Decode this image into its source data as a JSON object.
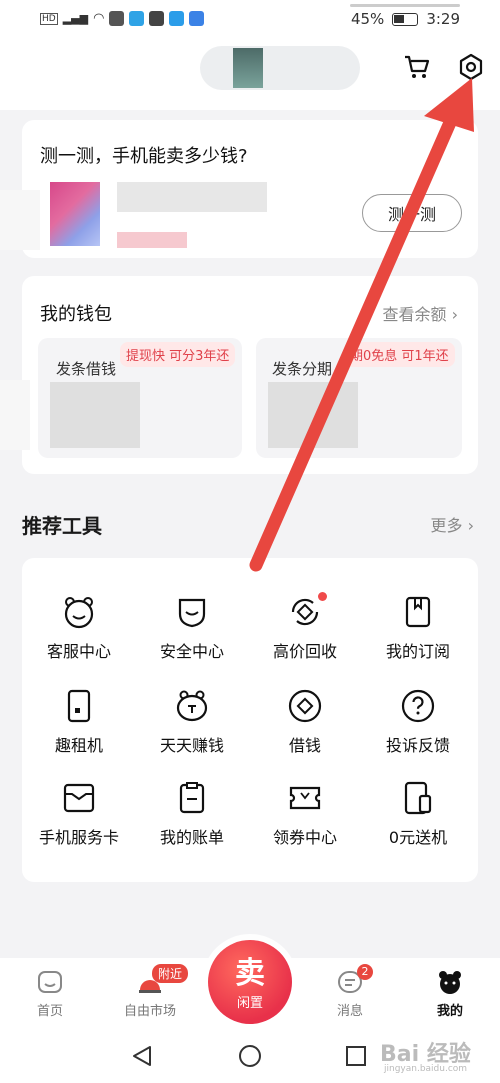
{
  "status_bar": {
    "battery": "45%",
    "time": "3:29"
  },
  "appraise_card": {
    "title": "测一测，手机能卖多少钱?",
    "button": "测一测"
  },
  "wallet": {
    "title": "我的钱包",
    "link": "查看余额",
    "left_title": "发条借钱",
    "left_tag": "提现快 可分3年还",
    "right_title": "发条分期",
    "right_tag": "期0免息 可1年还"
  },
  "tools": {
    "title": "推荐工具",
    "more": "更多",
    "items": [
      {
        "label": "客服中心",
        "icon": "bear-face-icon"
      },
      {
        "label": "安全中心",
        "icon": "shield-icon"
      },
      {
        "label": "高价回收",
        "icon": "recycle-icon"
      },
      {
        "label": "我的订阅",
        "icon": "bookmark-icon"
      },
      {
        "label": "趣租机",
        "icon": "phone-rent-icon"
      },
      {
        "label": "天天赚钱",
        "icon": "money-bear-icon"
      },
      {
        "label": "借钱",
        "icon": "coin-icon"
      },
      {
        "label": "投诉反馈",
        "icon": "question-icon"
      },
      {
        "label": "手机服务卡",
        "icon": "service-card-icon"
      },
      {
        "label": "我的账单",
        "icon": "bill-icon"
      },
      {
        "label": "领券中心",
        "icon": "coupon-icon"
      },
      {
        "label": "0元送机",
        "icon": "free-phone-icon"
      }
    ]
  },
  "tabbar": {
    "home": "首页",
    "market": "自由市场",
    "market_badge": "附近",
    "sell_big": "卖",
    "sell_small": "闲置",
    "messages": "消息",
    "messages_badge": "2",
    "mine": "我的"
  },
  "watermark": "Bai 经验",
  "watermark_sub": "jingyan.baidu.com",
  "colors": {
    "accent": "#e0414a",
    "arrow": "#e8473f",
    "badge": "#f04a4a"
  }
}
